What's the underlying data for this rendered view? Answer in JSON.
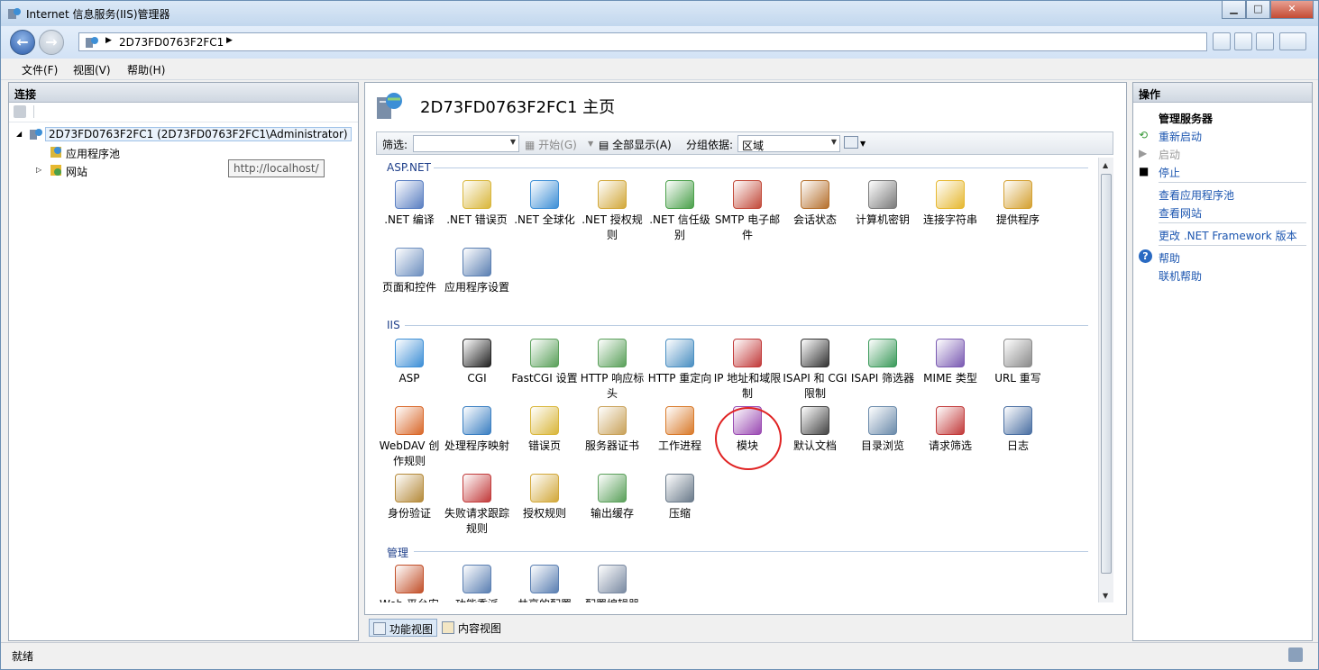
{
  "window": {
    "title": "Internet 信息服务(IIS)管理器"
  },
  "address": {
    "path": "2D73FD0763F2FC1"
  },
  "menu": [
    "文件(F)",
    "视图(V)",
    "帮助(H)"
  ],
  "connections": {
    "title": "连接",
    "server_node": "2D73FD0763F2FC1 (2D73FD0763F2FC1\\Administrator)",
    "app_pools": "应用程序池",
    "sites": "网站",
    "tooltip": "http://localhost/"
  },
  "main": {
    "title": "2D73FD0763F2FC1 主页",
    "filter_label": "筛选:",
    "go_label": "开始(G)",
    "show_all_label": "全部显示(A)",
    "group_by_label": "分组依据:",
    "group_by_value": "区域"
  },
  "groups": {
    "aspnet": {
      "name": "ASP.NET",
      "items": [
        {
          "label": ".NET 编译",
          "icon": "dotnet-compile-icon",
          "color": "#5a7fc2"
        },
        {
          "label": ".NET 错误页",
          "icon": "error-page-icon",
          "color": "#d9b63a"
        },
        {
          "label": ".NET 全球化",
          "icon": "globe-icon",
          "color": "#3d8fd6"
        },
        {
          "label": ".NET 授权规则",
          "icon": "lock-icon",
          "color": "#d2a83a"
        },
        {
          "label": ".NET 信任级别",
          "icon": "trust-icon",
          "color": "#4aa04a"
        },
        {
          "label": "SMTP 电子邮件",
          "icon": "mail-icon",
          "color": "#c24a3a"
        },
        {
          "label": "会话状态",
          "icon": "session-icon",
          "color": "#b5702d"
        },
        {
          "label": "计算机密钥",
          "icon": "machine-key-icon",
          "color": "#7a7a7a"
        },
        {
          "label": "连接字符串",
          "icon": "database-icon",
          "color": "#e6b830"
        },
        {
          "label": "提供程序",
          "icon": "providers-icon",
          "color": "#d4a030"
        },
        {
          "label": "页面和控件",
          "icon": "page-controls-icon",
          "color": "#6d8fbf"
        },
        {
          "label": "应用程序设置",
          "icon": "app-settings-icon",
          "color": "#5a7fb2"
        }
      ]
    },
    "iis": {
      "name": "IIS",
      "items": [
        {
          "label": "ASP",
          "icon": "asp-icon",
          "color": "#3d8fd6"
        },
        {
          "label": "CGI",
          "icon": "cgi-icon",
          "color": "#222222"
        },
        {
          "label": "FastCGI 设置",
          "icon": "fastcgi-icon",
          "color": "#5aa05a"
        },
        {
          "label": "HTTP 响应标头",
          "icon": "response-headers-icon",
          "color": "#5aa05a"
        },
        {
          "label": "HTTP 重定向",
          "icon": "redirect-icon",
          "color": "#4a8fc2"
        },
        {
          "label": "IP 地址和域限制",
          "icon": "ip-restrict-icon",
          "color": "#c23a3a"
        },
        {
          "label": "ISAPI 和 CGI 限制",
          "icon": "isapi-cgi-icon",
          "color": "#333333"
        },
        {
          "label": "ISAPI 筛选器",
          "icon": "isapi-filter-icon",
          "color": "#3a9a5a"
        },
        {
          "label": "MIME 类型",
          "icon": "mime-icon",
          "color": "#7a5ab2"
        },
        {
          "label": "URL 重写",
          "icon": "url-rewrite-icon",
          "color": "#8a8a8a"
        },
        {
          "label": "WebDAV 创作规则",
          "icon": "webdav-icon",
          "color": "#d9682a"
        },
        {
          "label": "处理程序映射",
          "icon": "handler-icon",
          "color": "#3a7fc2"
        },
        {
          "label": "错误页",
          "icon": "error-page-icon",
          "color": "#d9b63a"
        },
        {
          "label": "服务器证书",
          "icon": "certificate-icon",
          "color": "#c9a25a"
        },
        {
          "label": "工作进程",
          "icon": "worker-process-icon",
          "color": "#d97a2a"
        },
        {
          "label": "模块",
          "icon": "modules-icon",
          "color": "#9a4ab2"
        },
        {
          "label": "默认文档",
          "icon": "default-doc-icon",
          "color": "#444444"
        },
        {
          "label": "目录浏览",
          "icon": "dir-browse-icon",
          "color": "#6a8aaa"
        },
        {
          "label": "请求筛选",
          "icon": "request-filter-icon",
          "color": "#c23a3a"
        },
        {
          "label": "日志",
          "icon": "log-icon",
          "color": "#4a6fa2"
        },
        {
          "label": "身份验证",
          "icon": "auth-icon",
          "color": "#b58a3a"
        },
        {
          "label": "失败请求跟踪规则",
          "icon": "failed-trace-icon",
          "color": "#c23a3a"
        },
        {
          "label": "授权规则",
          "icon": "lock-icon",
          "color": "#d2a83a"
        },
        {
          "label": "输出缓存",
          "icon": "output-cache-icon",
          "color": "#5aa05a"
        },
        {
          "label": "压缩",
          "icon": "compress-icon",
          "color": "#6a7a8a"
        }
      ]
    },
    "manage": {
      "name": "管理",
      "items": [
        {
          "label": "Web 平台安装程序",
          "icon": "web-platform-icon",
          "color": "#c2502a"
        },
        {
          "label": "功能委派",
          "icon": "delegation-icon",
          "color": "#5a7fb2"
        },
        {
          "label": "共享的配置",
          "icon": "shared-config-icon",
          "color": "#5a7fb2"
        },
        {
          "label": "配置编辑器",
          "icon": "config-editor-icon",
          "color": "#7a8aa2"
        }
      ]
    }
  },
  "bottom_tabs": {
    "features": "功能视图",
    "content": "内容视图"
  },
  "actions": {
    "title": "操作",
    "manage_server": "管理服务器",
    "restart": "重新启动",
    "start": "启动",
    "stop": "停止",
    "view_app_pools": "查看应用程序池",
    "view_sites": "查看网站",
    "change_framework": "更改 .NET Framework 版本",
    "help": "帮助",
    "online_help": "联机帮助"
  },
  "status": {
    "text": "就绪"
  }
}
